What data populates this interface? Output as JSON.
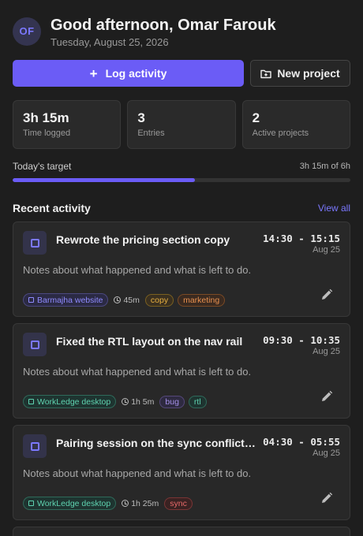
{
  "user": {
    "initials": "OF",
    "greeting": "Good afternoon, Omar Farouk",
    "date": "Tuesday, August 25, 2026"
  },
  "actions": {
    "log_label": "Log activity",
    "new_project_label": "New project"
  },
  "stats": [
    {
      "value": "3h 15m",
      "label": "Time logged"
    },
    {
      "value": "3",
      "label": "Entries"
    },
    {
      "value": "2",
      "label": "Active projects"
    }
  ],
  "target": {
    "label": "Today's target",
    "value": "3h 15m of 6h",
    "progress_fraction": 0.54
  },
  "recent": {
    "title": "Recent activity",
    "view_all": "View all"
  },
  "colors": {
    "accent": "#6b5cf6",
    "background": "#1e1e1e",
    "card": "#282828"
  },
  "entries": [
    {
      "title": "Rewrote the pricing section copy",
      "time": "14:30 - 15:15",
      "date": "Aug 25",
      "notes": "Notes about what happened and what is left to do.",
      "project": "Barmajha website",
      "duration": "45m",
      "tags": [
        "copy",
        "marketing"
      ]
    },
    {
      "title": "Fixed the RTL layout on the nav rail",
      "time": "09:30 - 10:35",
      "date": "Aug 25",
      "notes": "Notes about what happened and what is left to do.",
      "project": "WorkLedge desktop",
      "duration": "1h 5m",
      "tags": [
        "bug",
        "rtl"
      ]
    },
    {
      "title": "Pairing session on the sync conflict resolver",
      "time": "04:30 - 05:55",
      "date": "Aug 25",
      "notes": "Notes about what happened and what is left to do.",
      "project": "WorkLedge desktop",
      "duration": "1h 25m",
      "tags": [
        "sync"
      ]
    }
  ]
}
